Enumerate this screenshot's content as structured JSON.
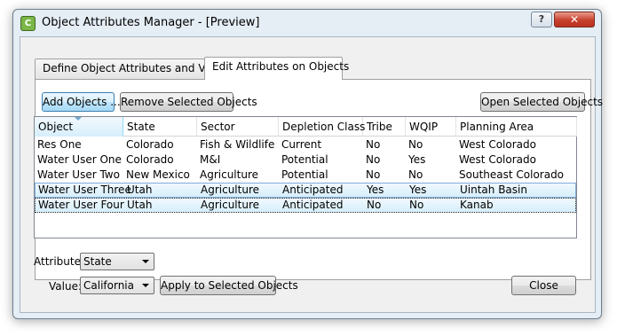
{
  "window": {
    "title": "Object Attributes Manager - [Preview]",
    "help_glyph": "?",
    "close_glyph": "✕",
    "app_icon_glyph": "C"
  },
  "tabs": [
    {
      "label": "Define Object Attributes and Values",
      "active": false
    },
    {
      "label": "Edit Attributes on Objects",
      "active": true
    }
  ],
  "toolbar": {
    "add_objects_label": "Add Objects ...",
    "remove_selected_label": "Remove Selected Objects",
    "open_selected_label": "Open Selected Objects"
  },
  "grid": {
    "columns": [
      "Object",
      "State",
      "Sector",
      "Depletion Class",
      "Tribe",
      "WQIP",
      "Planning Area"
    ],
    "sorted_column": "Object",
    "rows": [
      {
        "cells": [
          "Res One",
          "Colorado",
          "Fish & Wildlife",
          "Current",
          "No",
          "No",
          "West Colorado"
        ],
        "selected": false
      },
      {
        "cells": [
          "Water User One",
          "Colorado",
          "M&I",
          "Potential",
          "No",
          "Yes",
          "West Colorado"
        ],
        "selected": false
      },
      {
        "cells": [
          "Water User Two",
          "New Mexico",
          "Agriculture",
          "Potential",
          "No",
          "No",
          "Southeast Colorado"
        ],
        "selected": false
      },
      {
        "cells": [
          "Water User Three",
          "Utah",
          "Agriculture",
          "Anticipated",
          "Yes",
          "Yes",
          "Uintah Basin"
        ],
        "selected": true
      },
      {
        "cells": [
          "Water User Four",
          "Utah",
          "Agriculture",
          "Anticipated",
          "No",
          "No",
          "Kanab"
        ],
        "selected": true
      }
    ]
  },
  "attribute": {
    "label": "Attribute:",
    "value": "State"
  },
  "value_field": {
    "label": "Value:",
    "value": "California"
  },
  "apply_label": "Apply to Selected Objects",
  "close_label": "Close",
  "colors": {
    "selection": "#d5effc",
    "selection_border": "#84acdd",
    "window_frame": "#e5edf5",
    "close_button": "#c7412e"
  }
}
